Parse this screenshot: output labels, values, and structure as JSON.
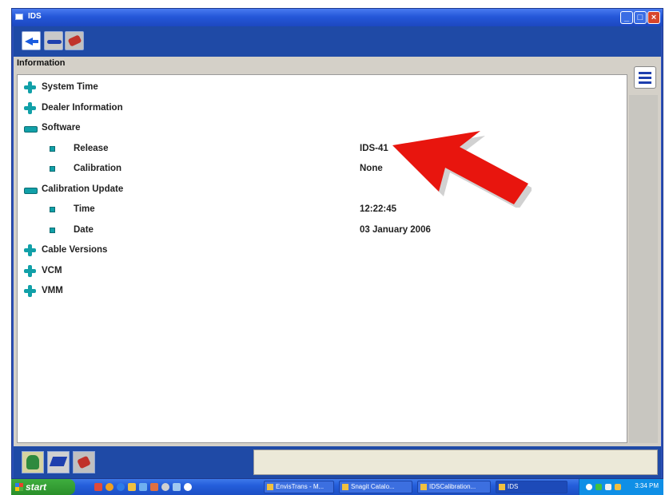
{
  "window": {
    "title": "IDS"
  },
  "panel": {
    "label": "Information"
  },
  "tree": [
    {
      "label": "System Time",
      "state": "collapsed",
      "level": 0,
      "value": ""
    },
    {
      "label": "Dealer Information",
      "state": "collapsed",
      "level": 0,
      "value": ""
    },
    {
      "label": "Software",
      "state": "expanded",
      "level": 0,
      "value": ""
    },
    {
      "label": "Release",
      "state": "leaf",
      "level": 1,
      "value": "IDS-41"
    },
    {
      "label": "Calibration",
      "state": "leaf",
      "level": 1,
      "value": "None"
    },
    {
      "label": "Calibration Update",
      "state": "expanded",
      "level": 0,
      "value": ""
    },
    {
      "label": "Time",
      "state": "leaf",
      "level": 1,
      "value": "12:22:45"
    },
    {
      "label": "Date",
      "state": "leaf",
      "level": 1,
      "value": "03 January 2006"
    },
    {
      "label": "Cable Versions",
      "state": "collapsed",
      "level": 0,
      "value": ""
    },
    {
      "label": "VCM",
      "state": "collapsed",
      "level": 0,
      "value": ""
    },
    {
      "label": "VMM",
      "state": "collapsed",
      "level": 0,
      "value": ""
    }
  ],
  "taskbar": {
    "start_label": "start",
    "tasks": [
      "EnvisTrans - M...",
      "Snagit Catalo...",
      "IDSCalibration...",
      "IDS"
    ],
    "clock": "3:34 PM"
  },
  "colors": {
    "titlebar": "#2457d8",
    "toolbar": "#1f4aa6",
    "tree_icon": "#11a0a8",
    "arrow": "#e8150e",
    "close_button": "#d8452a"
  }
}
